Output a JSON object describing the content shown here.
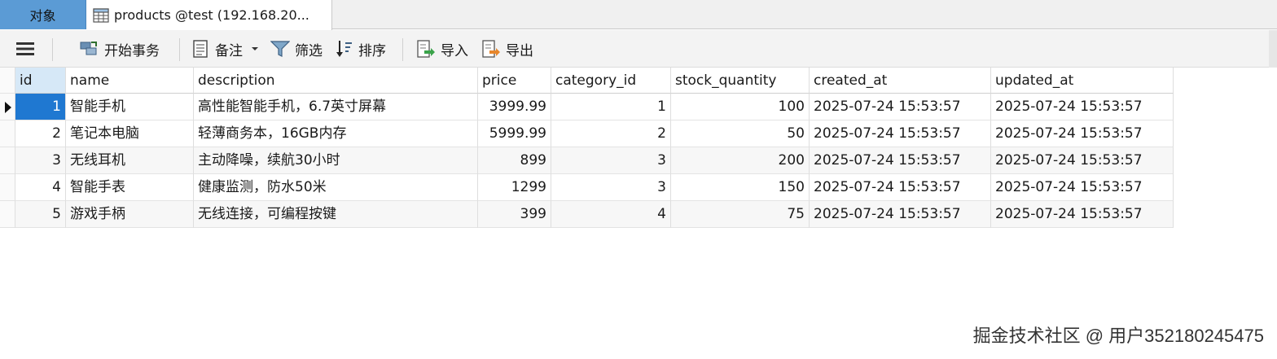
{
  "tabs": {
    "objects": "对象",
    "products": "products @test (192.168.20..."
  },
  "toolbar": {
    "begin_transaction": "开始事务",
    "memo": "备注",
    "filter": "筛选",
    "sort": "排序",
    "import": "导入",
    "export": "导出"
  },
  "columns": [
    "id",
    "name",
    "description",
    "price",
    "category_id",
    "stock_quantity",
    "created_at",
    "updated_at"
  ],
  "rows": [
    {
      "id": "1",
      "name": "智能手机",
      "description": "高性能智能手机，6.7英寸屏幕",
      "price": "3999.99",
      "category_id": "1",
      "stock_quantity": "100",
      "created_at": "2025-07-24 15:53:57",
      "updated_at": "2025-07-24 15:53:57"
    },
    {
      "id": "2",
      "name": "笔记本电脑",
      "description": "轻薄商务本，16GB内存",
      "price": "5999.99",
      "category_id": "2",
      "stock_quantity": "50",
      "created_at": "2025-07-24 15:53:57",
      "updated_at": "2025-07-24 15:53:57"
    },
    {
      "id": "3",
      "name": "无线耳机",
      "description": "主动降噪，续航30小时",
      "price": "899",
      "category_id": "3",
      "stock_quantity": "200",
      "created_at": "2025-07-24 15:53:57",
      "updated_at": "2025-07-24 15:53:57"
    },
    {
      "id": "4",
      "name": "智能手表",
      "description": "健康监测，防水50米",
      "price": "1299",
      "category_id": "3",
      "stock_quantity": "150",
      "created_at": "2025-07-24 15:53:57",
      "updated_at": "2025-07-24 15:53:57"
    },
    {
      "id": "5",
      "name": "游戏手柄",
      "description": "无线连接，可编程按键",
      "price": "399",
      "category_id": "4",
      "stock_quantity": "75",
      "created_at": "2025-07-24 15:53:57",
      "updated_at": "2025-07-24 15:53:57"
    }
  ],
  "watermark": "掘金技术社区 @ 用户352180245475",
  "colors": {
    "accent": "#1f78d1",
    "tab_active": "#5b9bd5"
  }
}
